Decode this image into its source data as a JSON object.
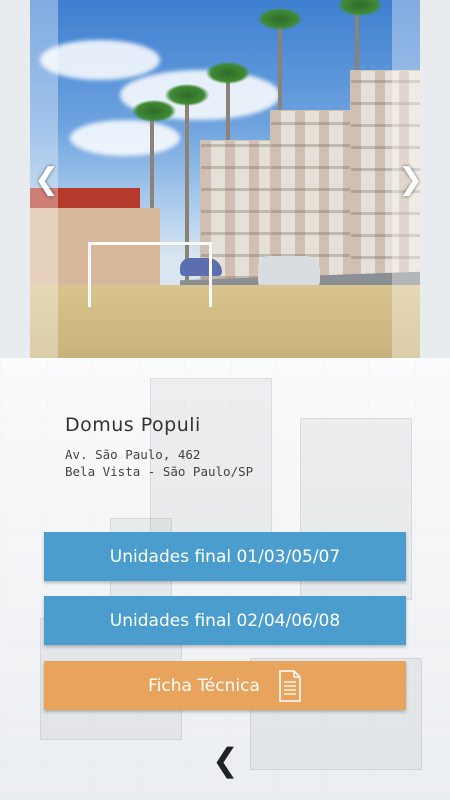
{
  "project": {
    "name": "Domus Populi",
    "address_line1": "Av. São Paulo, 462",
    "address_line2": "Bela Vista - São Paulo/SP"
  },
  "carousel": {
    "prev_icon": "chevron-left-icon",
    "next_icon": "chevron-right-icon"
  },
  "buttons": {
    "units_odd": "Unidades final 01/03/05/07",
    "units_even": "Unidades final 02/04/06/08",
    "tech_sheet": "Ficha Técnica",
    "tech_sheet_icon": "document-icon"
  },
  "nav": {
    "back_icon": "chevron-left-icon"
  },
  "colors": {
    "blue": "#4a9dcd",
    "orange": "#e8a35c",
    "text": "#333333"
  }
}
